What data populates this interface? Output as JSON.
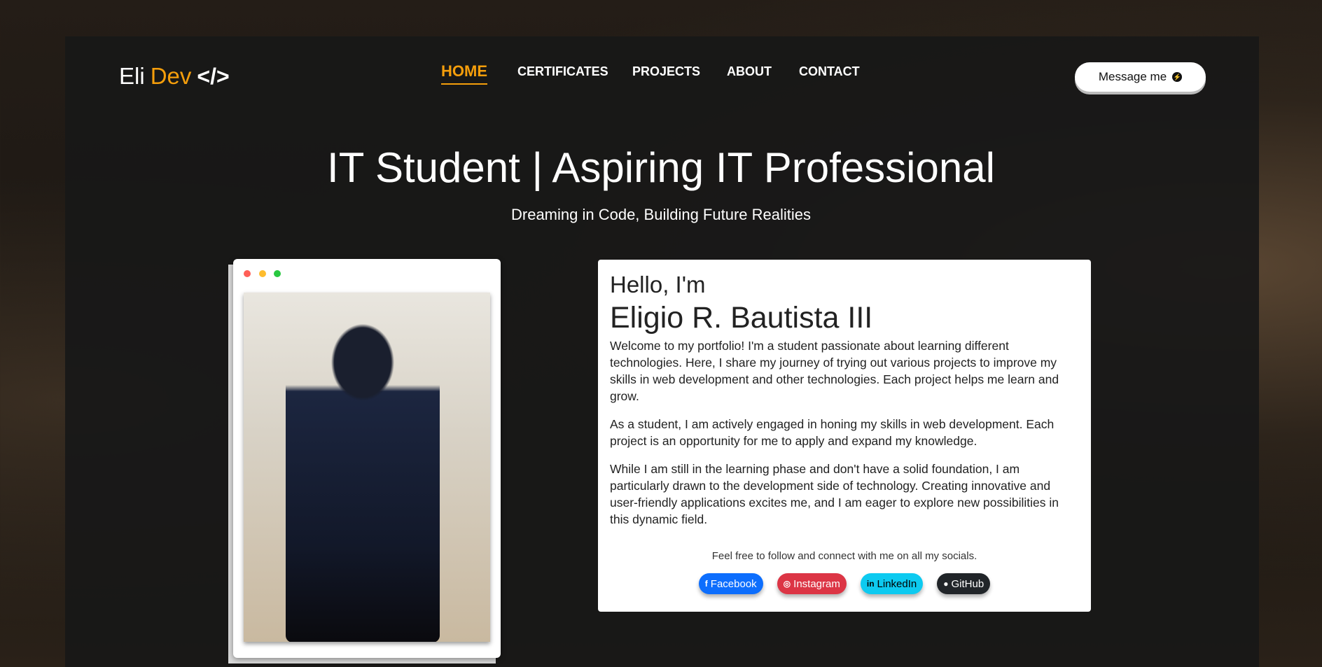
{
  "logo": {
    "first": "Eli",
    "second": "Dev",
    "code": "</>"
  },
  "nav": [
    {
      "label": "HOME",
      "active": true
    },
    {
      "label": "CERTIFICATES"
    },
    {
      "label": "PROJECTS"
    },
    {
      "label": "ABOUT"
    },
    {
      "label": "CONTACT"
    }
  ],
  "message_button": {
    "label": "Message me",
    "icon": "messenger-icon"
  },
  "hero": {
    "title": "IT Student | Aspiring IT Professional",
    "subtitle": "Dreaming in Code, Building Future Realities"
  },
  "intro": {
    "hello": "Hello, I'm",
    "name": "Eligio R. Bautista III",
    "paragraphs": [
      "Welcome to my portfolio! I'm a student passionate about learning different technologies. Here, I share my journey of trying out various projects to improve my skills in web development and other technologies. Each project helps me learn and grow.",
      "As a student, I am actively engaged in honing my skills in web development. Each project is an opportunity for me to apply and expand my knowledge.",
      "While I am still in the learning phase and don't have a solid foundation, I am particularly drawn to the development side of technology. Creating innovative and user-friendly applications excites me, and I am eager to explore new possibilities in this dynamic field."
    ],
    "follow": "Feel free to follow and connect with me on all my socials."
  },
  "socials": [
    {
      "label": "Facebook",
      "icon": "facebook-icon",
      "glyph": "f",
      "color": "#0d6efd",
      "text": "#ffffff"
    },
    {
      "label": "Instagram",
      "icon": "instagram-icon",
      "glyph": "◎",
      "color": "#dc3545",
      "text": "#ffffff"
    },
    {
      "label": "LinkedIn",
      "icon": "linkedin-icon",
      "glyph": "in",
      "color": "#0dcaf0",
      "text": "#000000"
    },
    {
      "label": "GitHub",
      "icon": "github-icon",
      "glyph": "●",
      "color": "#212529",
      "text": "#ffffff"
    }
  ],
  "colors": {
    "accent": "#f59e0b"
  }
}
